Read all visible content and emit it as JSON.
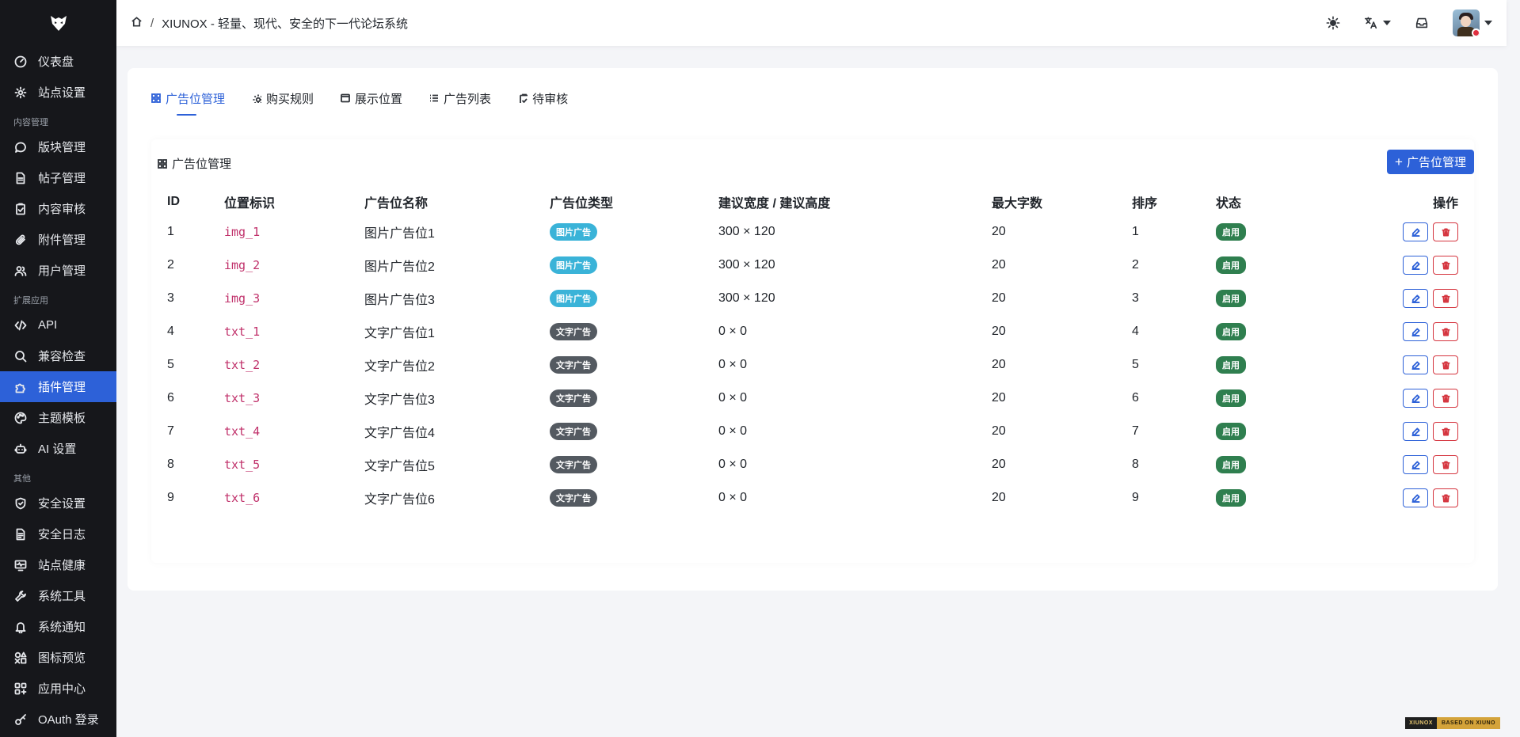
{
  "sidebar": {
    "items": [
      {
        "label": "仪表盘",
        "icon": "dashboard-icon"
      },
      {
        "label": "站点设置",
        "icon": "gear-icon"
      },
      {
        "group": "内容管理"
      },
      {
        "label": "版块管理",
        "icon": "chat-icon"
      },
      {
        "label": "帖子管理",
        "icon": "document-icon"
      },
      {
        "label": "内容审核",
        "icon": "clipboard-check-icon"
      },
      {
        "label": "附件管理",
        "icon": "paperclip-icon"
      },
      {
        "label": "用户管理",
        "icon": "users-icon"
      },
      {
        "group": "扩展应用"
      },
      {
        "label": "API",
        "icon": "code-icon"
      },
      {
        "label": "兼容检查",
        "icon": "search-icon"
      },
      {
        "label": "插件管理",
        "icon": "puzzle-icon",
        "active": true
      },
      {
        "label": "主题模板",
        "icon": "palette-icon"
      },
      {
        "label": "AI 设置",
        "icon": "robot-icon"
      },
      {
        "group": "其他"
      },
      {
        "label": "安全设置",
        "icon": "shield-icon"
      },
      {
        "label": "安全日志",
        "icon": "log-icon"
      },
      {
        "label": "站点健康",
        "icon": "monitor-heart-icon"
      },
      {
        "label": "系统工具",
        "icon": "wrench-icon"
      },
      {
        "label": "系统通知",
        "icon": "bell-icon"
      },
      {
        "label": "图标预览",
        "icon": "shapes-icon"
      },
      {
        "label": "应用中心",
        "icon": "apps-icon"
      },
      {
        "label": "OAuth 登录",
        "icon": "key-icon"
      }
    ]
  },
  "header": {
    "breadcrumb_sep": "/",
    "title": "XIUNOX - 轻量、现代、安全的下一代论坛系统"
  },
  "tabs": [
    {
      "label": "广告位管理",
      "icon": "grid-icon",
      "active": true
    },
    {
      "label": "购买规则",
      "icon": "gear-icon"
    },
    {
      "label": "展示位置",
      "icon": "window-icon"
    },
    {
      "label": "广告列表",
      "icon": "list-icon"
    },
    {
      "label": "待审核",
      "icon": "clipboard-check-icon"
    }
  ],
  "section": {
    "title": "广告位管理",
    "add_button": "广告位管理",
    "add_symbol": "+"
  },
  "table": {
    "columns": [
      "ID",
      "位置标识",
      "广告位名称",
      "广告位类型",
      "建议宽度 / 建议高度",
      "最大字数",
      "排序",
      "状态",
      "操作"
    ],
    "rows": [
      {
        "id": "1",
        "key": "img_1",
        "name": "图片广告位1",
        "type": "图片广告",
        "type_kind": "img",
        "size": "300 × 120",
        "max": "20",
        "sort": "1",
        "status": "启用"
      },
      {
        "id": "2",
        "key": "img_2",
        "name": "图片广告位2",
        "type": "图片广告",
        "type_kind": "img",
        "size": "300 × 120",
        "max": "20",
        "sort": "2",
        "status": "启用"
      },
      {
        "id": "3",
        "key": "img_3",
        "name": "图片广告位3",
        "type": "图片广告",
        "type_kind": "img",
        "size": "300 × 120",
        "max": "20",
        "sort": "3",
        "status": "启用"
      },
      {
        "id": "4",
        "key": "txt_1",
        "name": "文字广告位1",
        "type": "文字广告",
        "type_kind": "txt",
        "size": "0 × 0",
        "max": "20",
        "sort": "4",
        "status": "启用"
      },
      {
        "id": "5",
        "key": "txt_2",
        "name": "文字广告位2",
        "type": "文字广告",
        "type_kind": "txt",
        "size": "0 × 0",
        "max": "20",
        "sort": "5",
        "status": "启用"
      },
      {
        "id": "6",
        "key": "txt_3",
        "name": "文字广告位3",
        "type": "文字广告",
        "type_kind": "txt",
        "size": "0 × 0",
        "max": "20",
        "sort": "6",
        "status": "启用"
      },
      {
        "id": "7",
        "key": "txt_4",
        "name": "文字广告位4",
        "type": "文字广告",
        "type_kind": "txt",
        "size": "0 × 0",
        "max": "20",
        "sort": "7",
        "status": "启用"
      },
      {
        "id": "8",
        "key": "txt_5",
        "name": "文字广告位5",
        "type": "文字广告",
        "type_kind": "txt",
        "size": "0 × 0",
        "max": "20",
        "sort": "8",
        "status": "启用"
      },
      {
        "id": "9",
        "key": "txt_6",
        "name": "文字广告位6",
        "type": "文字广告",
        "type_kind": "txt",
        "size": "0 × 0",
        "max": "20",
        "sort": "9",
        "status": "启用"
      }
    ]
  },
  "footer_badge": {
    "left": "XIUNOX",
    "right": "BASED ON XIUNO"
  },
  "colors": {
    "accent": "#2d61d8",
    "sidebar_bg": "#16171b",
    "danger": "#d5353f",
    "success": "#2f7f4f",
    "info": "#3ab3d8"
  }
}
